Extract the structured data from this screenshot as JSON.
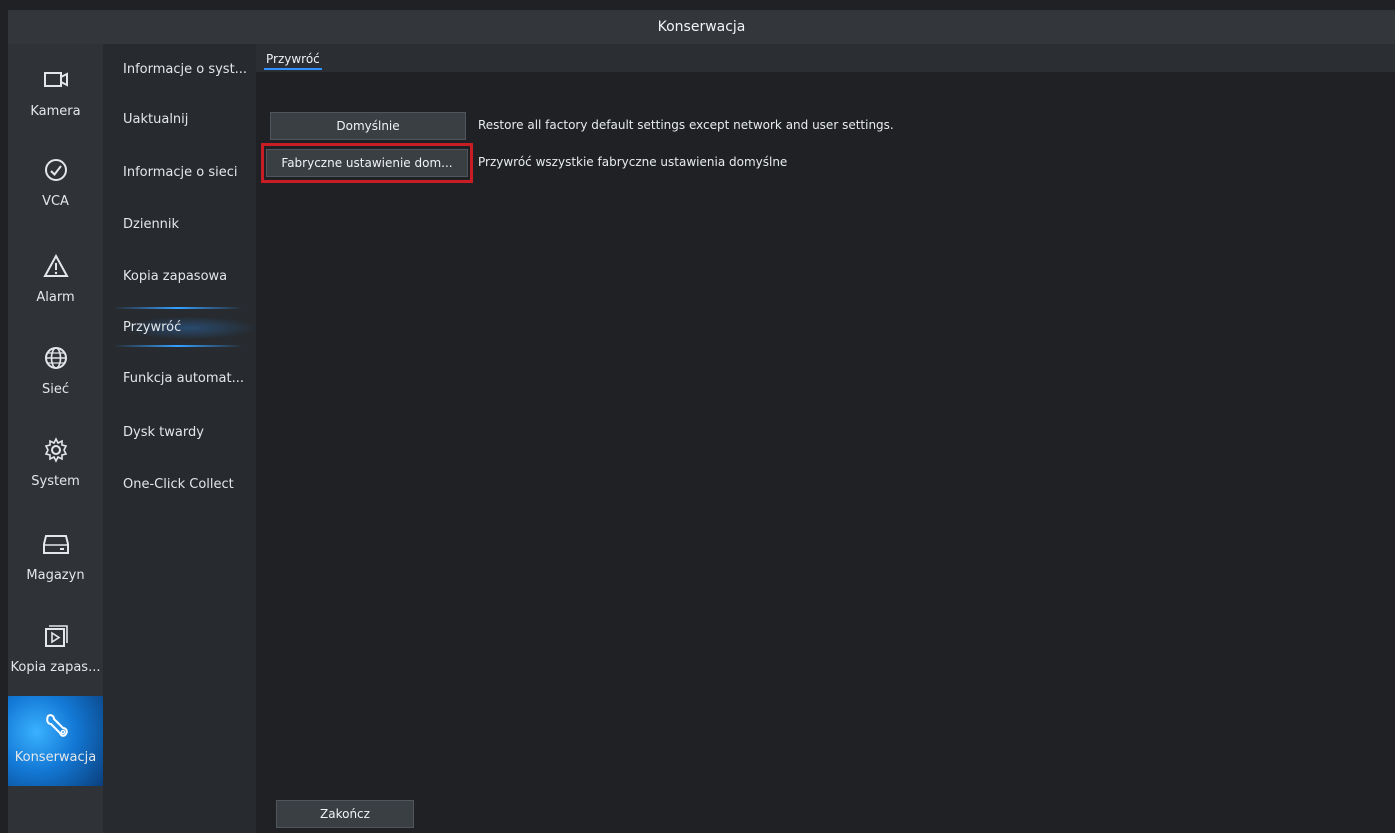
{
  "window": {
    "title": "Konserwacja"
  },
  "left_nav": {
    "items": [
      {
        "label": "Kamera",
        "icon": "camera-icon"
      },
      {
        "label": "VCA",
        "icon": "vca-icon"
      },
      {
        "label": "Alarm",
        "icon": "alarm-icon"
      },
      {
        "label": "Sieć",
        "icon": "network-globe-icon"
      },
      {
        "label": "System",
        "icon": "system-gear-icon"
      },
      {
        "label": "Magazyn",
        "icon": "storage-icon"
      },
      {
        "label": "Kopia zapas...",
        "icon": "backup-icon"
      },
      {
        "label": "Konserwacja",
        "icon": "maintenance-wrench-icon",
        "active": true
      }
    ],
    "active_color": "#1a86e6"
  },
  "submenu": {
    "items": [
      {
        "label": "Informacje o syst..."
      },
      {
        "label": "Uaktualnij"
      },
      {
        "label": "Informacje o sieci"
      },
      {
        "label": "Dziennik"
      },
      {
        "label": "Kopia zapasowa"
      },
      {
        "label": "Przywróć",
        "active": true
      },
      {
        "label": "Funkcja automat..."
      },
      {
        "label": "Dysk twardy"
      },
      {
        "label": "One-Click Collect"
      }
    ]
  },
  "tabs": [
    {
      "label": "Przywróć",
      "active": true
    }
  ],
  "content": {
    "rows": [
      {
        "button_label": "Domyślnie",
        "description": "Restore all factory default settings except network and user settings."
      },
      {
        "button_label": "Fabryczne ustawienie dom...",
        "description": "Przywróć wszystkie fabryczne ustawienia domyślne",
        "highlighted": true
      }
    ],
    "exit_button_label": "Zakończ"
  },
  "colors": {
    "background": "#1f2124",
    "highlight_border": "#c81d25",
    "accent": "#2f92ff"
  }
}
